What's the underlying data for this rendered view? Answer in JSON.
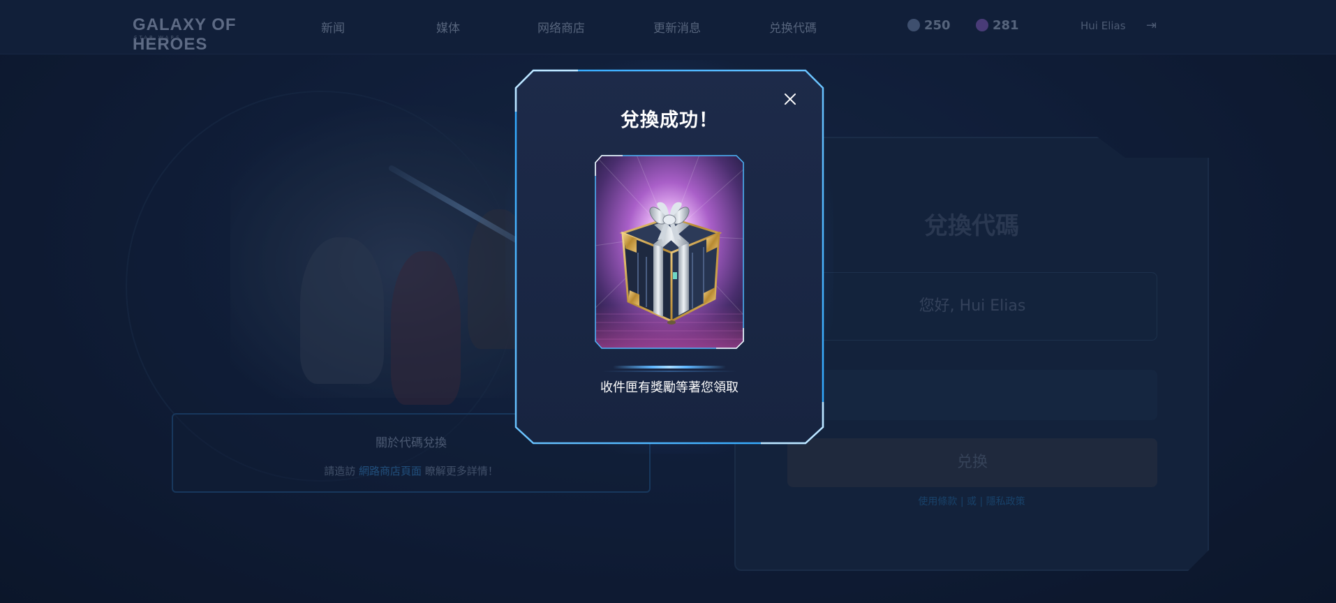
{
  "header": {
    "logo_main": "GALAXY OF HEROES",
    "logo_sub": "STAR WARS",
    "nav": [
      "新闻",
      "媒体",
      "网络商店",
      "更新消息",
      "兑换代碼"
    ],
    "currencies": [
      {
        "name": "crystals",
        "value": "250",
        "color": "#5a6e92"
      },
      {
        "name": "gems",
        "value": "281",
        "color": "#6a4fa0"
      }
    ],
    "user_name": "Hui Elias",
    "logout_icon": "logout-icon"
  },
  "background": {
    "info_title": "關於代碼兌換",
    "info_text_pre": "請造訪",
    "info_link": "網路商店頁面",
    "info_text_post": "瞭解更多詳情！",
    "panel_title": "兌換代碼",
    "panel_input_value": "您好, Hui Elias",
    "panel_button": "兑换",
    "panel_link_1": "使用條款",
    "panel_link_sep": "| 或 |",
    "panel_link_2": "隱私政策"
  },
  "modal": {
    "title": "兌換成功！",
    "close_icon": "close-icon",
    "reward_image": "gift-box-image",
    "message": "收件匣有獎勵等著您領取",
    "accent_color": "#3aa7ff"
  }
}
